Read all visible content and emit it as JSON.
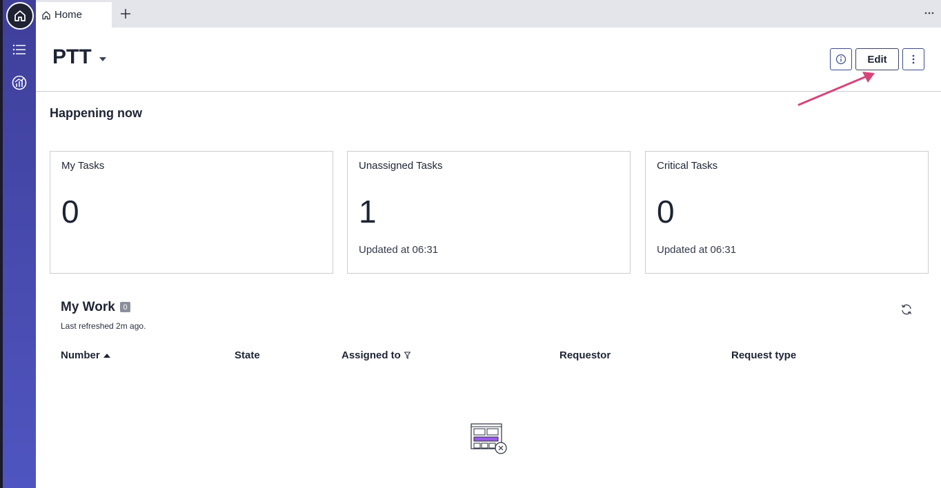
{
  "tabs": {
    "home_label": "Home"
  },
  "header": {
    "title": "PTT",
    "edit_label": "Edit"
  },
  "happening": {
    "title": "Happening now",
    "cards": [
      {
        "title": "My Tasks",
        "value": "0",
        "updated": ""
      },
      {
        "title": "Unassigned Tasks",
        "value": "1",
        "updated": "Updated at 06:31"
      },
      {
        "title": "Critical Tasks",
        "value": "0",
        "updated": "Updated at 06:31"
      }
    ]
  },
  "mywork": {
    "title": "My Work",
    "count": "0",
    "refreshed": "Last refreshed 2m ago.",
    "columns": [
      "Number",
      "State",
      "Assigned to",
      "Requestor",
      "Request type"
    ]
  },
  "colors": {
    "sidebar": "#4f55c0",
    "annotation_arrow": "#d6457a",
    "illustration_accent": "#9b5de5"
  },
  "icons": [
    "home-icon",
    "list-icon",
    "analytics-icon",
    "plus-icon",
    "more-horizontal-icon",
    "info-icon",
    "more-vertical-icon",
    "caret-down-icon",
    "refresh-icon",
    "sort-ascending-icon",
    "filter-icon",
    "empty-state-icon"
  ]
}
